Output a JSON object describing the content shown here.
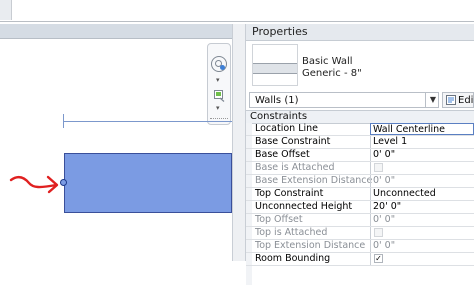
{
  "properties": {
    "title": "Properties",
    "type_name_line1": "Basic Wall",
    "type_name_line2": "Generic - 8\"",
    "selector_label": "Walls (1)",
    "edit_type_label": "Edi",
    "section": "Constraints",
    "rows": [
      {
        "name": "Location Line",
        "value": "Wall Centerline",
        "disabled": false,
        "checkbox": false
      },
      {
        "name": "Base Constraint",
        "value": "Level 1",
        "disabled": false,
        "checkbox": false
      },
      {
        "name": "Base Offset",
        "value": "0' 0\"",
        "disabled": false,
        "checkbox": false
      },
      {
        "name": "Base is Attached",
        "value": "",
        "disabled": true,
        "checkbox": true,
        "checked": false
      },
      {
        "name": "Base Extension Distance",
        "value": "0' 0\"",
        "disabled": true,
        "checkbox": false
      },
      {
        "name": "Top Constraint",
        "value": "Unconnected",
        "disabled": false,
        "checkbox": false
      },
      {
        "name": "Unconnected Height",
        "value": "20' 0\"",
        "disabled": false,
        "checkbox": false
      },
      {
        "name": "Top Offset",
        "value": "0' 0\"",
        "disabled": true,
        "checkbox": false
      },
      {
        "name": "Top is Attached",
        "value": "",
        "disabled": true,
        "checkbox": true,
        "checked": false
      },
      {
        "name": "Top Extension Distance",
        "value": "0' 0\"",
        "disabled": true,
        "checkbox": false
      },
      {
        "name": "Room Bounding",
        "value": "",
        "disabled": false,
        "checkbox": true,
        "checked": true
      }
    ]
  },
  "view": {
    "close_glyph": "×",
    "colors": {
      "wall_fill": "#7b9be3",
      "level_line": "#7c98cc",
      "annotation": "#e02020"
    }
  },
  "icons": [
    "close-icon",
    "steering-wheel-icon",
    "zoom-icon",
    "dropdown-arrow-icon",
    "edit-type-icon",
    "checkbox-icon"
  ]
}
